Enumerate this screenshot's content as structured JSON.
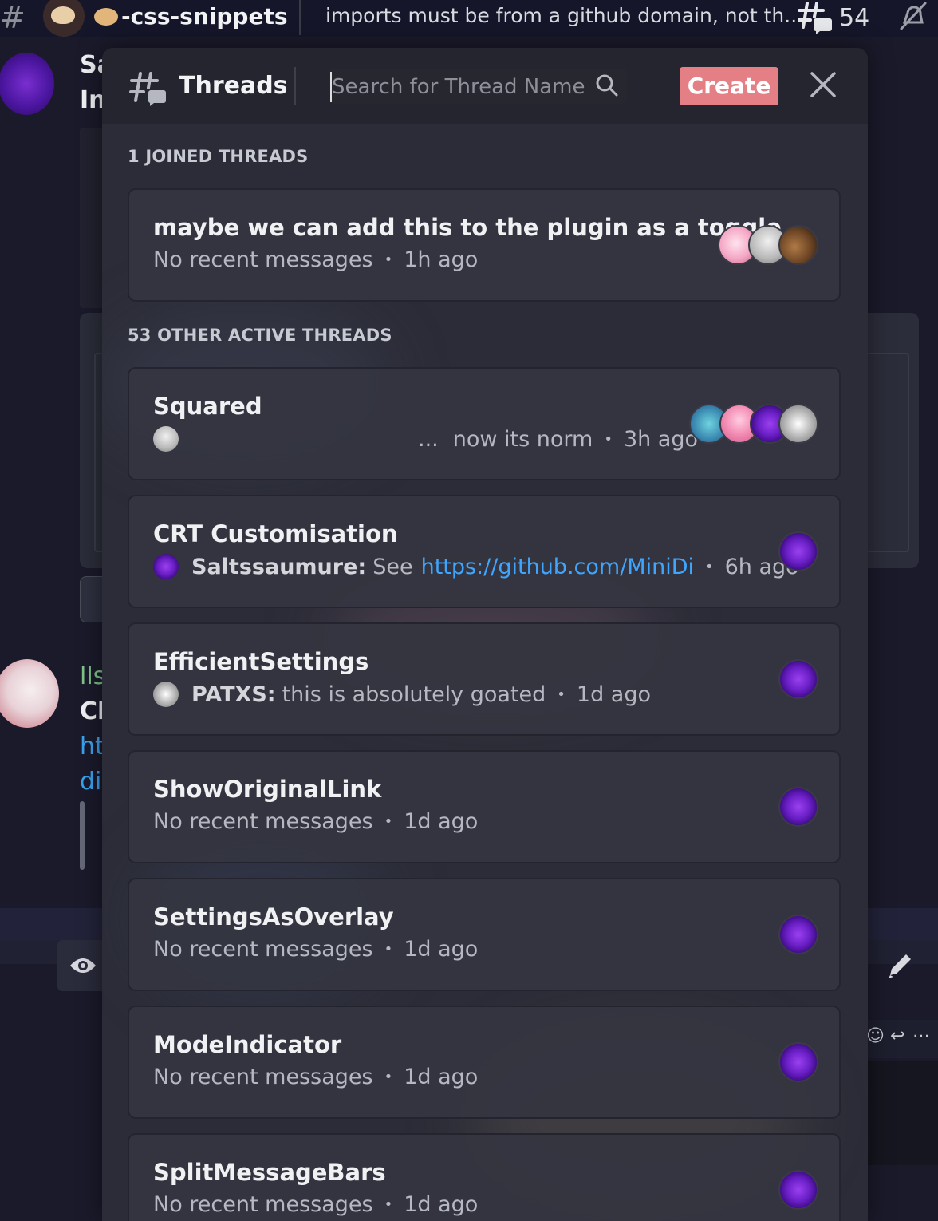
{
  "topbar": {
    "channel_name": "-css-snippets",
    "topic": "imports must be from a github domain, not th...",
    "threads_count": "54"
  },
  "background_chat": {
    "name1_top": "Sa",
    "name1_bottom": "In",
    "name2": "lls",
    "line2": "Cl",
    "link1": "ht",
    "link2": "di"
  },
  "popout": {
    "title": "Threads",
    "search_placeholder": "Search for Thread Name",
    "create_label": "Create",
    "joined_header": "1 JOINED THREADS",
    "other_header": "53 OTHER ACTIVE THREADS",
    "joined_threads": [
      {
        "title": "maybe we can add this to the plugin as a toggle",
        "preview": "No recent messages",
        "time": "1h ago",
        "participants": [
          "avatar-pink",
          "avatar-grey",
          "avatar-bear"
        ]
      }
    ],
    "other_threads": [
      {
        "title": "Squared",
        "ellipsis": "...",
        "preview": "now its norm",
        "time": "3h ago",
        "participants": [
          "avatar-man",
          "avatar-pinkhat",
          "avatar-purple",
          "avatar-bw"
        ]
      },
      {
        "title": "CRT Customisation",
        "author": "Saltssaumure:",
        "preview": "See",
        "link": "https://github.com/MiniDi",
        "time": "6h ago",
        "participants": [
          "avatar-purple"
        ]
      },
      {
        "title": "EfficientSettings",
        "author": "PATXS:",
        "preview": "this is absolutely goated",
        "time": "1d ago",
        "participants": [
          "avatar-purple"
        ]
      },
      {
        "title": "ShowOriginalLink",
        "preview": "No recent messages",
        "time": "1d ago",
        "participants": [
          "avatar-purple"
        ]
      },
      {
        "title": "SettingsAsOverlay",
        "preview": "No recent messages",
        "time": "1d ago",
        "participants": [
          "avatar-purple"
        ]
      },
      {
        "title": "ModeIndicator",
        "preview": "No recent messages",
        "time": "1d ago",
        "participants": [
          "avatar-purple"
        ]
      },
      {
        "title": "SplitMessageBars",
        "preview": "No recent messages",
        "time": "1d ago",
        "participants": [
          "avatar-purple"
        ]
      }
    ],
    "separator": "•"
  },
  "colors": {
    "create_button": "#e57f86",
    "link": "#3ea6ff",
    "panel": "#2b2c37",
    "card": "#343540"
  }
}
